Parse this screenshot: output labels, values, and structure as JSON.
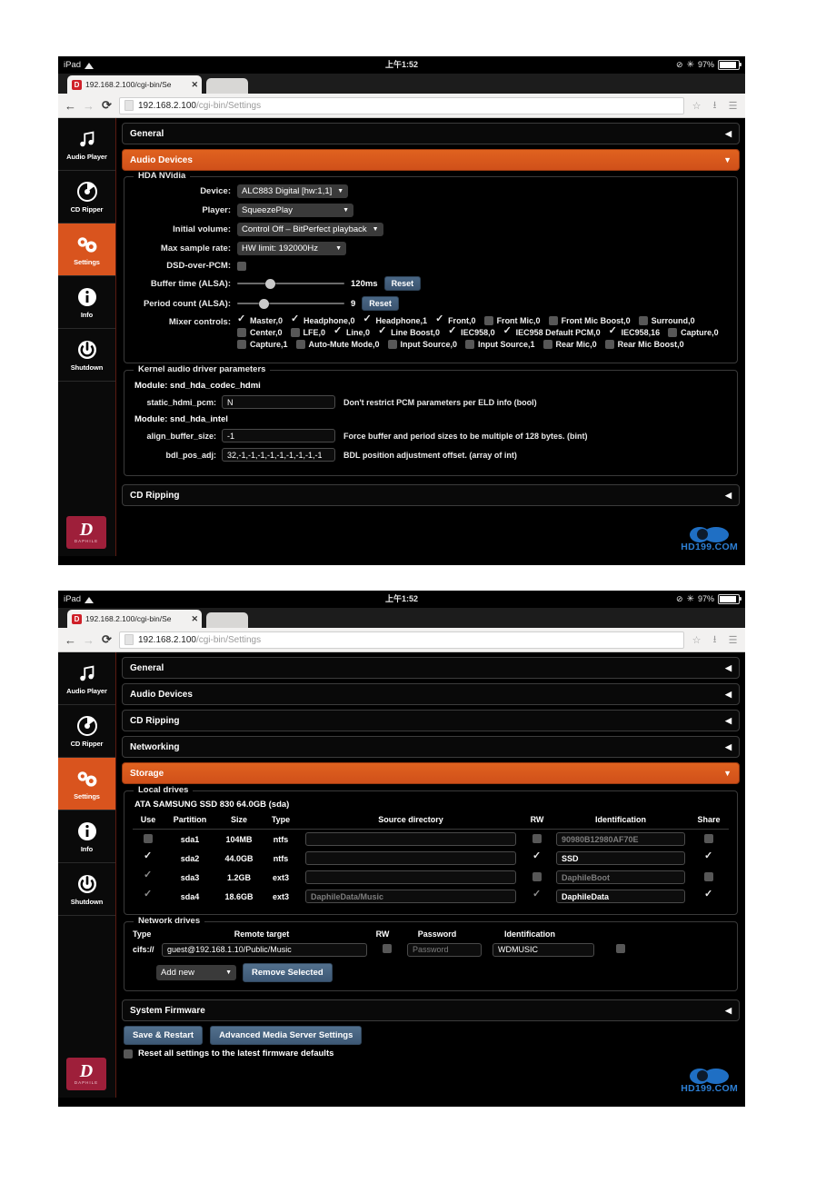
{
  "status_bar": {
    "device": "iPad",
    "wifi_icon": "wifi-icon",
    "time": "上午1:52",
    "bluetooth_icon": "bluetooth-icon",
    "battery_text": "97%",
    "battery_icon": "battery-icon",
    "rotation_icon": "rotation-lock-icon"
  },
  "browser": {
    "tab_title": "192.168.2.100/cgi-bin/Se",
    "tab_close": "✕",
    "back_icon": "back-arrow-icon",
    "forward_icon": "forward-arrow-icon",
    "reload_icon": "C",
    "url_host": "192.168.2.100",
    "url_path": "/cgi-bin/Settings",
    "bookmark_icon": "star-icon",
    "download_icon": "download-icon",
    "menu_icon": "hamburger-menu-icon"
  },
  "sidebar": {
    "items": [
      {
        "label": "Audio Player",
        "icon": "music-note-icon",
        "active": false
      },
      {
        "label": "CD Ripper",
        "icon": "compact-disc-icon",
        "active": false
      },
      {
        "label": "Settings",
        "icon": "gears-icon",
        "active": true
      },
      {
        "label": "Info",
        "icon": "info-circle-icon",
        "active": false
      },
      {
        "label": "Shutdown",
        "icon": "power-icon",
        "active": false
      }
    ],
    "logo_letter": "D",
    "logo_sub": "DAPHILE"
  },
  "watermark": {
    "text": "HD199.COM",
    "icon": "eye-logo-icon"
  },
  "screen1": {
    "accordions_top": [
      {
        "label": "General",
        "state": "collapsed",
        "caret": "◀"
      },
      {
        "label": "Audio Devices",
        "state": "expanded",
        "caret": "▼"
      }
    ],
    "accordion_bottom": {
      "label": "CD Ripping",
      "state": "collapsed",
      "caret": "◀"
    },
    "hda": {
      "title": "HDA NVidia",
      "device_label": "Device:",
      "device_value": "ALC883 Digital [hw:1,1]",
      "player_label": "Player:",
      "player_value": "SqueezePlay",
      "initial_volume_label": "Initial volume:",
      "initial_volume_value": "Control Off – BitPerfect playback",
      "max_rate_label": "Max sample rate:",
      "max_rate_value": "HW limit: 192000Hz",
      "dsd_label": "DSD-over-PCM:",
      "dsd_checked": false,
      "buffer_label": "Buffer time (ALSA):",
      "buffer_value": "120ms",
      "buffer_pct": 26,
      "period_label": "Period count (ALSA):",
      "period_value": "9",
      "period_pct": 20,
      "reset_label": "Reset",
      "mixer_label": "Mixer controls:",
      "mixer": [
        {
          "name": "Master,0",
          "checked": true
        },
        {
          "name": "Headphone,0",
          "checked": true
        },
        {
          "name": "Headphone,1",
          "checked": true
        },
        {
          "name": "Front,0",
          "checked": true
        },
        {
          "name": "Front Mic,0",
          "checked": false
        },
        {
          "name": "Front Mic Boost,0",
          "checked": false
        },
        {
          "name": "Surround,0",
          "checked": false
        },
        {
          "name": "Center,0",
          "checked": false
        },
        {
          "name": "LFE,0",
          "checked": false
        },
        {
          "name": "Line,0",
          "checked": true
        },
        {
          "name": "Line Boost,0",
          "checked": true
        },
        {
          "name": "IEC958,0",
          "checked": true
        },
        {
          "name": "IEC958 Default PCM,0",
          "checked": true
        },
        {
          "name": "IEC958,16",
          "checked": true
        },
        {
          "name": "Capture,0",
          "checked": false
        },
        {
          "name": "Capture,1",
          "checked": false
        },
        {
          "name": "Auto-Mute Mode,0",
          "checked": false
        },
        {
          "name": "Input Source,0",
          "checked": false
        },
        {
          "name": "Input Source,1",
          "checked": false
        },
        {
          "name": "Rear Mic,0",
          "checked": false
        },
        {
          "name": "Rear Mic Boost,0",
          "checked": false
        }
      ]
    },
    "kernel": {
      "title": "Kernel audio driver parameters",
      "modules": [
        {
          "module_label": "Module: snd_hda_codec_hdmi",
          "params": [
            {
              "key": "static_hdmi_pcm:",
              "value": "N",
              "desc": "Don't restrict PCM parameters per ELD info (bool)"
            }
          ]
        },
        {
          "module_label": "Module: snd_hda_intel",
          "params": [
            {
              "key": "align_buffer_size:",
              "value": "-1",
              "desc": "Force buffer and period sizes to be multiple of 128 bytes. (bint)"
            },
            {
              "key": "bdl_pos_adj:",
              "value": "32,-1,-1,-1,-1,-1,-1,-1,-1,-1",
              "desc": "BDL position adjustment offset. (array of int)"
            }
          ]
        }
      ]
    }
  },
  "screen2": {
    "accordions": [
      {
        "label": "General",
        "state": "collapsed",
        "caret": "◀"
      },
      {
        "label": "Audio Devices",
        "state": "collapsed",
        "caret": "◀"
      },
      {
        "label": "CD Ripping",
        "state": "collapsed",
        "caret": "◀"
      },
      {
        "label": "Networking",
        "state": "collapsed",
        "caret": "◀"
      },
      {
        "label": "Storage",
        "state": "expanded",
        "caret": "▼"
      }
    ],
    "accordion_firmware": {
      "label": "System Firmware",
      "state": "collapsed",
      "caret": "◀"
    },
    "local_drives": {
      "title": "Local drives",
      "disk": "ATA SAMSUNG SSD 830 64.0GB (sda)",
      "headers": [
        "Use",
        "Partition",
        "Size",
        "Type",
        "Source directory",
        "RW",
        "Identification",
        "Share"
      ],
      "rows": [
        {
          "use": false,
          "use_dim": false,
          "partition": "sda1",
          "size": "104MB",
          "type": "ntfs",
          "source": "",
          "source_ph": "",
          "rw": false,
          "rw_dim": false,
          "ident": "90980B12980AF70E",
          "ident_ph": true,
          "share": false,
          "share_dim": false
        },
        {
          "use": true,
          "use_dim": false,
          "partition": "sda2",
          "size": "44.0GB",
          "type": "ntfs",
          "source": "",
          "source_ph": "",
          "rw": true,
          "rw_dim": false,
          "ident": "SSD",
          "ident_ph": false,
          "share": true,
          "share_dim": false
        },
        {
          "use": true,
          "use_dim": true,
          "partition": "sda3",
          "size": "1.2GB",
          "type": "ext3",
          "source": "",
          "source_ph": "",
          "rw": false,
          "rw_dim": false,
          "ident": "DaphileBoot",
          "ident_ph": true,
          "share": false,
          "share_dim": false
        },
        {
          "use": true,
          "use_dim": true,
          "partition": "sda4",
          "size": "18.6GB",
          "type": "ext3",
          "source": "",
          "source_ph": "DaphileData/Music",
          "rw": true,
          "rw_dim": true,
          "ident": "DaphileData",
          "ident_ph": false,
          "share": true,
          "share_dim": false
        }
      ]
    },
    "network_drives": {
      "title": "Network drives",
      "headers": [
        "Type",
        "Remote target",
        "RW",
        "Password",
        "Identification"
      ],
      "rows": [
        {
          "type": "cifs://",
          "target": "guest@192.168.1.10/Public/Music",
          "rw": false,
          "password_ph": "Password",
          "password": "",
          "ident": "WDMUSIC",
          "extra": false
        }
      ],
      "add_new_label": "Add new",
      "add_new_caret": "▼",
      "remove_label": "Remove Selected"
    },
    "footer": {
      "save_label": "Save & Restart",
      "advanced_label": "Advanced Media Server Settings",
      "reset_label": "Reset all settings to the latest firmware defaults",
      "reset_checked": false
    }
  }
}
